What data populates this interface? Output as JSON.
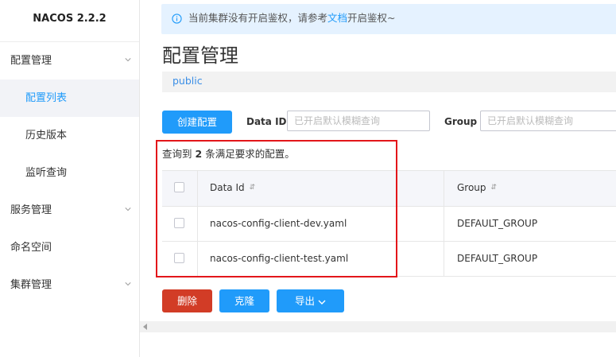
{
  "app": {
    "logo": "NACOS 2.2.2"
  },
  "sidebar": {
    "items": [
      {
        "label": "配置管理"
      },
      {
        "label": "配置列表"
      },
      {
        "label": "历史版本"
      },
      {
        "label": "监听查询"
      },
      {
        "label": "服务管理"
      },
      {
        "label": "命名空间"
      },
      {
        "label": "集群管理"
      }
    ]
  },
  "notice": {
    "text_before": "当前集群没有开启鉴权，请参考",
    "link": "文档",
    "text_after": "开启鉴权~"
  },
  "page": {
    "title": "配置管理",
    "namespace": "public"
  },
  "toolbar": {
    "create_label": "创建配置",
    "data_id_label": "Data ID",
    "data_id_placeholder": "已开启默认模糊查询",
    "group_label": "Group",
    "group_placeholder": "已开启默认模糊查询"
  },
  "result": {
    "prefix": "查询到",
    "count": "2",
    "suffix": "条满足要求的配置。"
  },
  "table": {
    "columns": [
      "Data Id",
      "Group"
    ],
    "rows": [
      {
        "data_id": "nacos-config-client-dev.yaml",
        "group": "DEFAULT_GROUP"
      },
      {
        "data_id": "nacos-config-client-test.yaml",
        "group": "DEFAULT_GROUP"
      }
    ]
  },
  "actions": {
    "delete_label": "删除",
    "clone_label": "克隆",
    "export_label": "导出"
  },
  "colors": {
    "primary": "#209bfa",
    "danger": "#d23c26",
    "highlight": "#e3161a"
  }
}
